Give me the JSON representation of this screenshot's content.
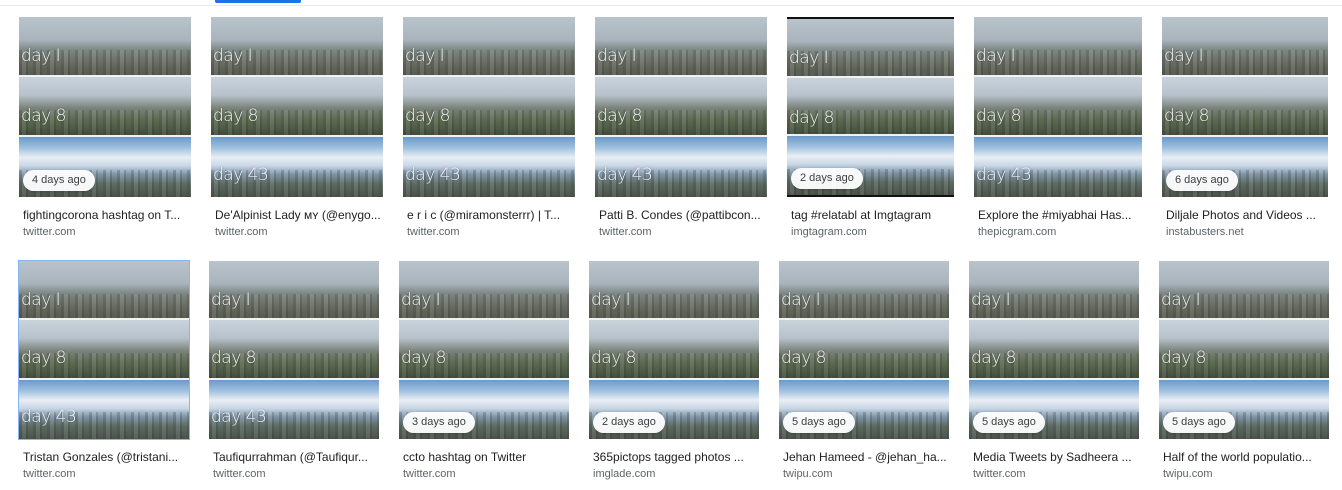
{
  "tabs_indicator": "active",
  "labels": {
    "top": "day I",
    "mid": "day 8",
    "bottom": "day 43"
  },
  "cards": [
    {
      "title": "fightingcorona hashtag on T...",
      "source": "twitter.com",
      "badge": "4 days ago"
    },
    {
      "title": "De'Alpinist Lady ᴍʏ (@enygo...",
      "source": "twitter.com",
      "badge": ""
    },
    {
      "title": "e r i c (@miramonsterrr) | T...",
      "source": "twitter.com",
      "badge": ""
    },
    {
      "title": "Patti B. Condes (@pattibcon...",
      "source": "twitter.com",
      "badge": ""
    },
    {
      "title": "tag #relatabl at Imgtagram",
      "source": "imgtagram.com",
      "badge": "2 days ago"
    },
    {
      "title": "Explore the #miyabhai Has...",
      "source": "thepicgram.com",
      "badge": ""
    },
    {
      "title": "Diljale Photos and Videos ...",
      "source": "instabusters.net",
      "badge": "6 days ago"
    },
    {
      "title": "Tristan Gonzales (@tristani...",
      "source": "twitter.com",
      "badge": ""
    },
    {
      "title": "Taufiqurrahman (@Taufiqur...",
      "source": "twitter.com",
      "badge": ""
    },
    {
      "title": "ccto hashtag on Twitter",
      "source": "twitter.com",
      "badge": "3 days ago"
    },
    {
      "title": "365pictops tagged photos ...",
      "source": "imglade.com",
      "badge": "2 days ago"
    },
    {
      "title": "Jehan Hameed - @jehan_ha...",
      "source": "twipu.com",
      "badge": "5 days ago"
    },
    {
      "title": "Media Tweets by Sadheera ...",
      "source": "twitter.com",
      "badge": "5 days ago"
    },
    {
      "title": "Half of the world populatio...",
      "source": "twipu.com",
      "badge": "5 days ago"
    }
  ]
}
